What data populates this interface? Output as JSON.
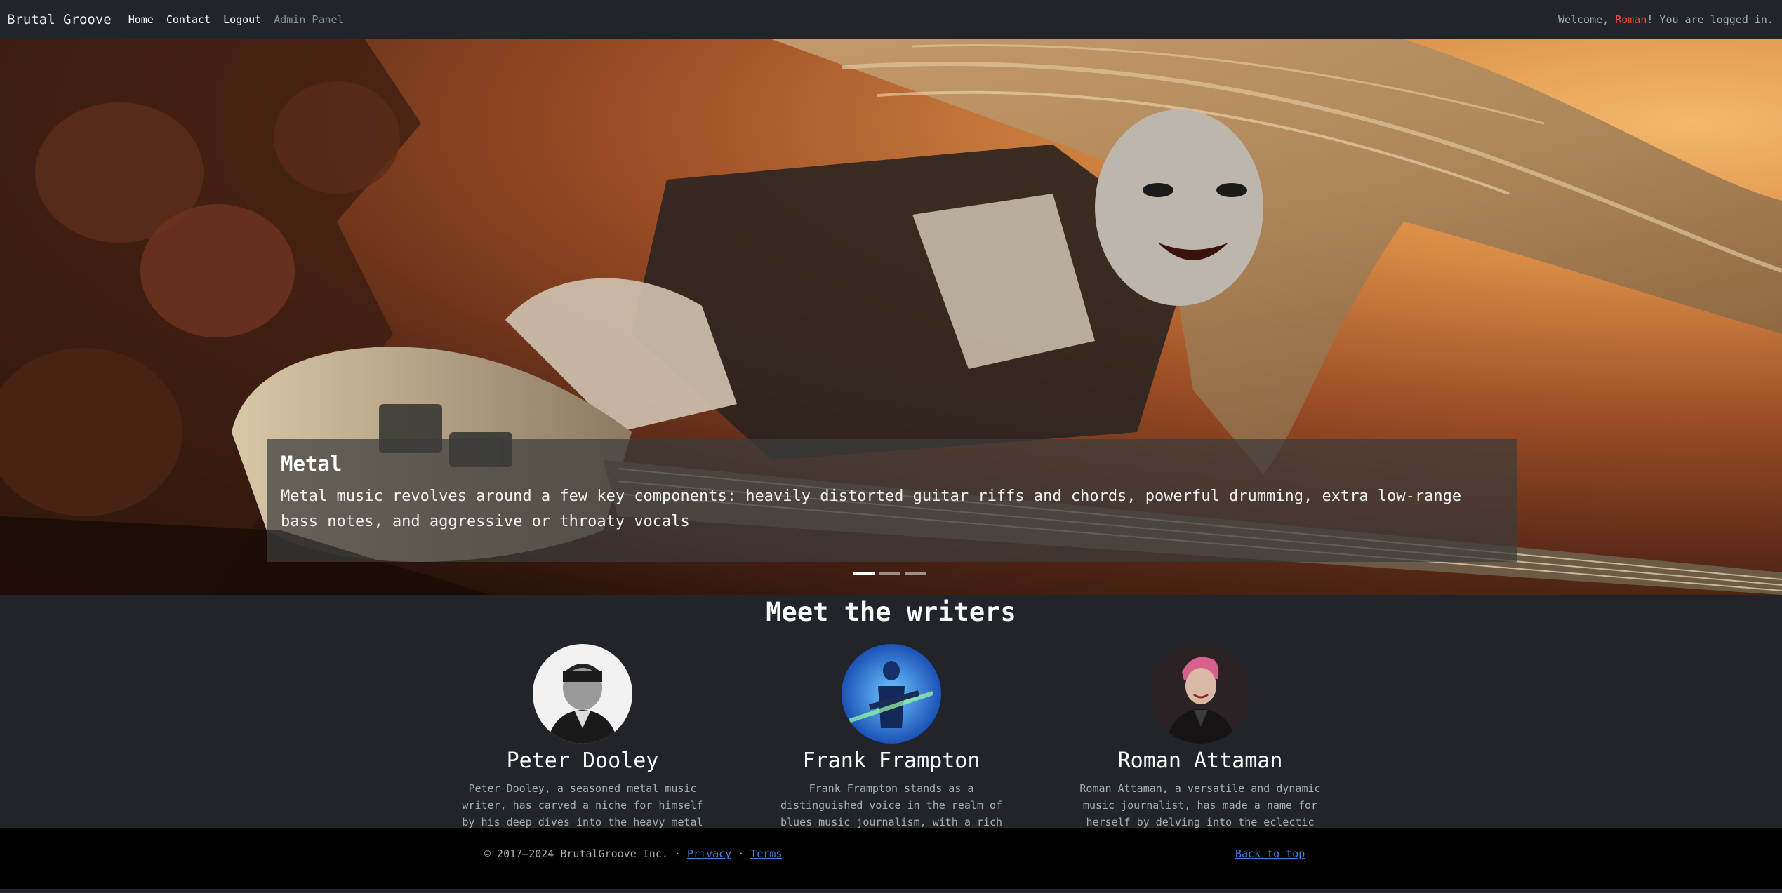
{
  "navbar": {
    "brand": "Brutal Groove",
    "links": [
      {
        "label": "Home"
      },
      {
        "label": "Contact"
      },
      {
        "label": "Logout"
      },
      {
        "label": "Admin Panel"
      }
    ],
    "welcome_prefix": "Welcome, ",
    "welcome_user": "Roman",
    "welcome_suffix": "! You are logged in."
  },
  "carousel": {
    "slide_title": "Metal",
    "slide_text": "Metal music revolves around a few key components: heavily distorted guitar riffs and chords, powerful drumming, extra low-range bass notes, and aggressive or throaty vocals",
    "slide_count": 3,
    "active_index": 0
  },
  "writers_section": {
    "title": "Meet the writers",
    "writers": [
      {
        "name": "Peter Dooley",
        "bio": "Peter Dooley, a seasoned metal music writer, has carved a niche for himself by his deep dives into the heavy metal genre, unearthing the"
      },
      {
        "name": "Frank Frampton",
        "bio": "Frank Frampton stands as a distinguished voice in the realm of blues music journalism, with a rich history of exploring the soulful depths and"
      },
      {
        "name": "Roman Attaman",
        "bio": "Roman Attaman, a versatile and dynamic music journalist, has made a name for herself by delving into the eclectic and cutting-edge"
      }
    ]
  },
  "footer": {
    "copyright": "© 2017–2024 BrutalGroove Inc. · ",
    "privacy": "Privacy",
    "separator": " · ",
    "terms": "Terms",
    "back_to_top": "Back to top"
  },
  "colors": {
    "background": "#212529",
    "footer": "#000000",
    "accent_user": "#e74c3c",
    "link": "#4a7fe6"
  }
}
